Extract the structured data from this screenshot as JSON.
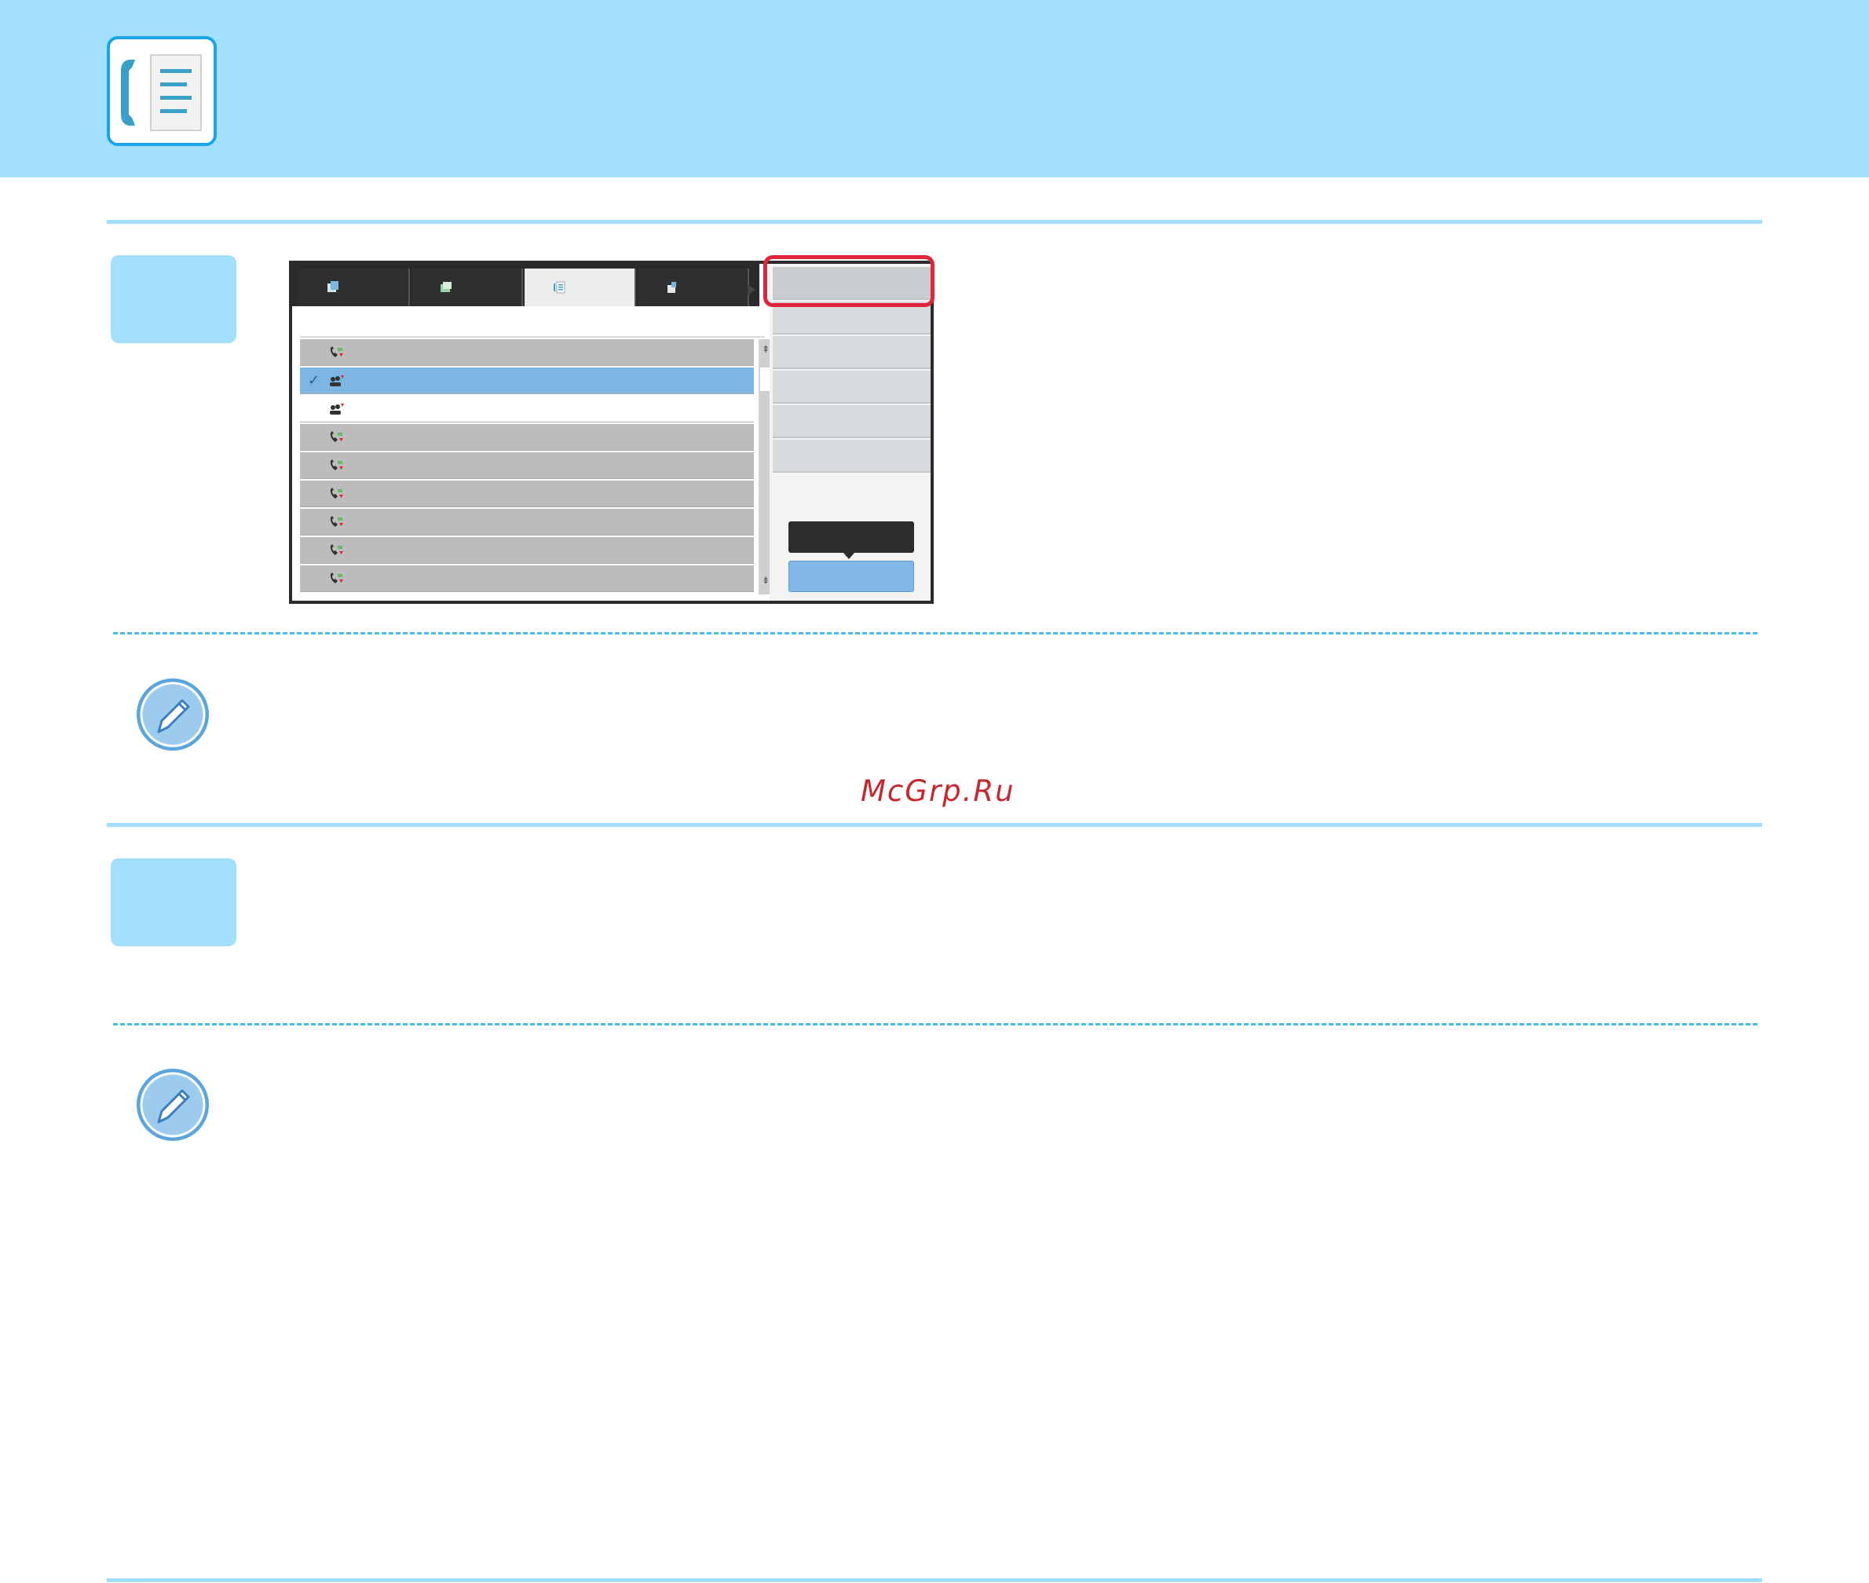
{
  "header": {
    "logo_icon": "fax-address-book-icon",
    "band_color": "#a3e0fd"
  },
  "watermark": {
    "text": "McGrp.Ru",
    "color": "#c6272c"
  },
  "screen": {
    "tab_icons": [
      "copy-icon",
      "scan-icon",
      "fax-icon",
      "scan-to-usb-icon"
    ],
    "active_tab": 2,
    "rows": [
      {
        "icon": "fax-contact-icon",
        "state": "normal",
        "checked": false
      },
      {
        "icon": "group-icon",
        "state": "selected",
        "checked": true
      },
      {
        "icon": "group-icon",
        "state": "white",
        "checked": false
      },
      {
        "icon": "fax-contact-icon",
        "state": "normal",
        "checked": false
      },
      {
        "icon": "fax-contact-icon",
        "state": "normal",
        "checked": false
      },
      {
        "icon": "fax-contact-icon",
        "state": "normal",
        "checked": false
      },
      {
        "icon": "fax-contact-icon",
        "state": "normal",
        "checked": false
      },
      {
        "icon": "fax-contact-icon",
        "state": "normal",
        "checked": false
      },
      {
        "icon": "fax-contact-icon",
        "state": "normal",
        "checked": false
      }
    ],
    "menu_count": 6,
    "highlight_color": "#e0243a",
    "check_mark": "✓",
    "scroll_up": "⇞",
    "scroll_down": "⇟"
  }
}
